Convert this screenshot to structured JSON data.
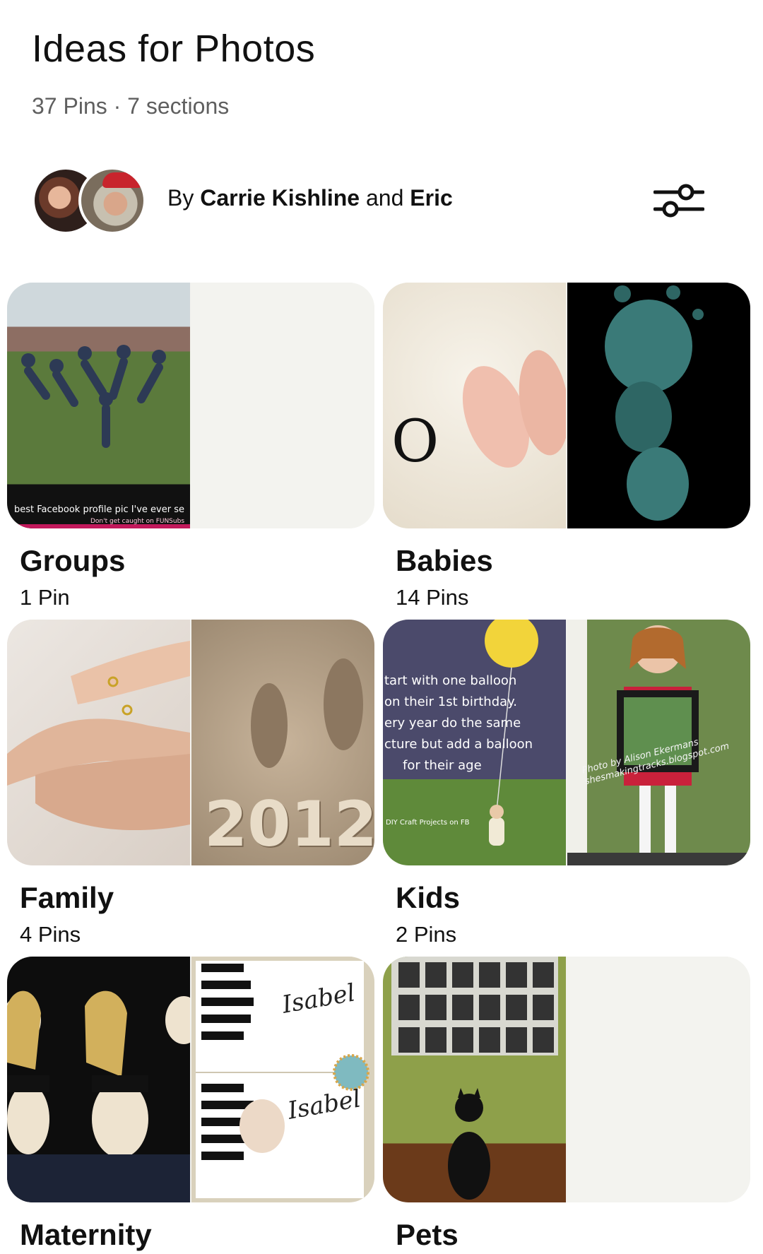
{
  "header": {
    "title": "Ideas for Photos",
    "meta": "37 Pins · 7 sections"
  },
  "owners": {
    "by": "By",
    "owner1": "Carrie Kishline",
    "and": "and",
    "owner2": "Eric"
  },
  "boards": [
    {
      "name": "Groups",
      "count": "1 Pin",
      "caption": "best Facebook profile pic I've ever se",
      "caption2": "Don't get caught on FUNSubs"
    },
    {
      "name": "Babies",
      "count": "14 Pins",
      "glyph": "O"
    },
    {
      "name": "Family",
      "count": "4 Pins",
      "sand_text": "2012"
    },
    {
      "name": "Kids",
      "count": "2 Pins",
      "balloon_lines": [
        "tart with one balloon",
        "on their 1st birthday.",
        "ery year do the same",
        "cture but add a balloon",
        "for their age"
      ],
      "credit": "DIY Craft Projects on FB",
      "photo_credit": "Photo by Alison Ekermans shesmakingtracks.blogspot.com"
    },
    {
      "name": "Maternity",
      "count": "",
      "name_text": "Isabel"
    },
    {
      "name": "Pets",
      "count": ""
    }
  ],
  "colors": {
    "accent": "#111111",
    "muted": "#5f5f5f",
    "placeholder": "#f3f3ef"
  }
}
